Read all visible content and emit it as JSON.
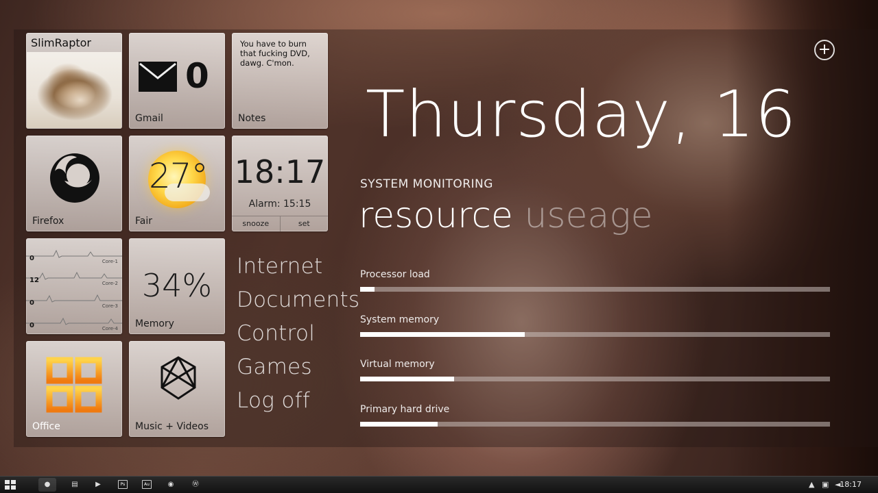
{
  "tiles": {
    "profile": {
      "name": "SlimRaptor"
    },
    "gmail": {
      "count": "0",
      "label": "Gmail"
    },
    "notes": {
      "text": "You have to burn that fucking DVD, dawg. C'mon.",
      "label": "Notes"
    },
    "firefox": {
      "label": "Firefox"
    },
    "weather": {
      "temp": "27°",
      "label": "Fair"
    },
    "alarm": {
      "time": "18:17",
      "alarm_text": "Alarm: 15:15",
      "snooze": "snooze",
      "set": "set"
    },
    "cpu": {
      "cores": [
        {
          "value": "0",
          "name": "Core-1"
        },
        {
          "value": "12",
          "name": "Core-2"
        },
        {
          "value": "0",
          "name": "Core-3"
        },
        {
          "value": "0",
          "name": "Core-4"
        }
      ]
    },
    "memory": {
      "percent": "34%",
      "label": "Memory"
    },
    "office": {
      "label": "Office"
    },
    "music": {
      "label": "Music + Videos"
    }
  },
  "nav": [
    "Internet",
    "Documents",
    "Control",
    "Games",
    "Log off"
  ],
  "date": "Thursday, 16",
  "monitor": {
    "heading": "SYSTEM MONITORING",
    "title_main": "resource",
    "title_dim": "useage",
    "meters": [
      {
        "label": "Processor load",
        "fraction": 0.03
      },
      {
        "label": "System memory",
        "fraction": 0.35
      },
      {
        "label": "Virtual memory",
        "fraction": 0.2
      },
      {
        "label": "Primary hard drive",
        "fraction": 0.165
      }
    ]
  },
  "taskbar": {
    "buttons": [
      "firefox",
      "explorer",
      "media-player",
      "Ps",
      "Au",
      "chrome",
      "wordpress"
    ],
    "clock": "18:17"
  },
  "colors": {
    "office_orange": "#f39c12",
    "meter_fill": "#ffffff"
  }
}
